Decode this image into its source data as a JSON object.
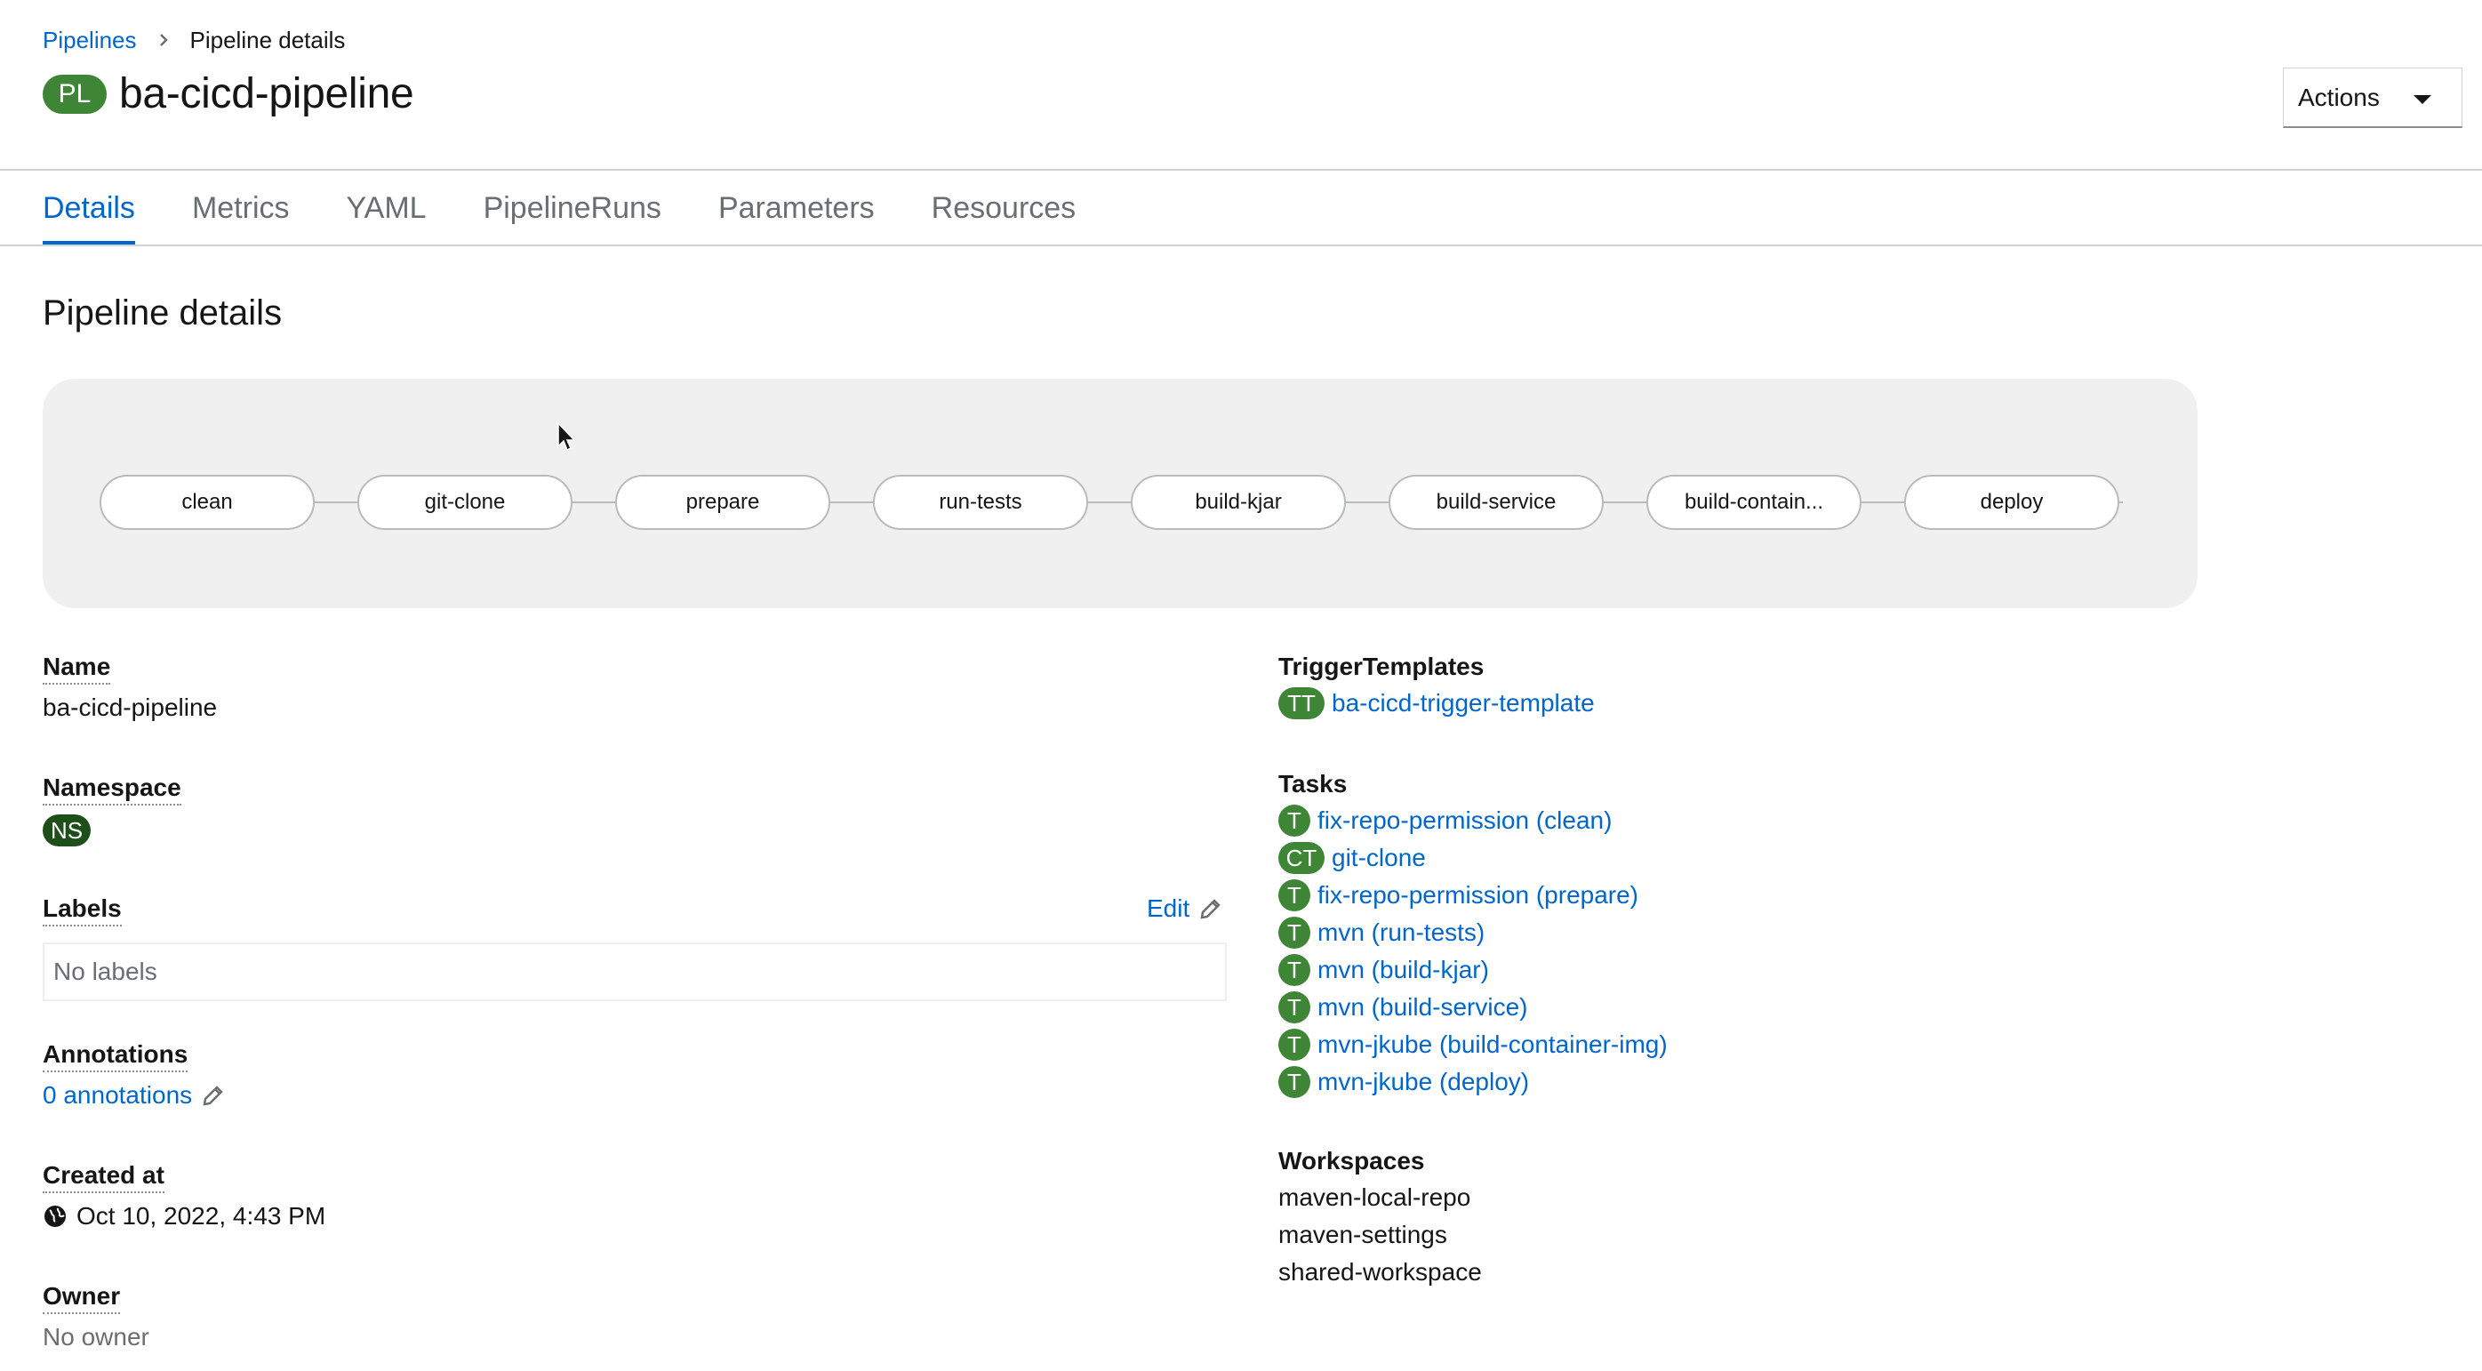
{
  "breadcrumb": {
    "parent": "Pipelines",
    "current": "Pipeline details"
  },
  "header": {
    "badge": "PL",
    "title": "ba-cicd-pipeline",
    "actions_label": "Actions"
  },
  "tabs": [
    "Details",
    "Metrics",
    "YAML",
    "PipelineRuns",
    "Parameters",
    "Resources"
  ],
  "active_tab": "Details",
  "section_title": "Pipeline details",
  "pipeline_nodes": [
    "clean",
    "git-clone",
    "prepare",
    "run-tests",
    "build-kjar",
    "build-service",
    "build-contain...",
    "deploy"
  ],
  "details": {
    "name_label": "Name",
    "name_value": "ba-cicd-pipeline",
    "namespace_label": "Namespace",
    "namespace_badge": "NS",
    "labels_label": "Labels",
    "labels_edit": "Edit",
    "labels_value": "No labels",
    "annotations_label": "Annotations",
    "annotations_value": "0 annotations",
    "created_label": "Created at",
    "created_value": "Oct 10, 2022, 4:43 PM",
    "owner_label": "Owner",
    "owner_value": "No owner"
  },
  "trigger_templates": {
    "label": "TriggerTemplates",
    "items": [
      {
        "badge": "TT",
        "name": "ba-cicd-trigger-template"
      }
    ]
  },
  "tasks": {
    "label": "Tasks",
    "items": [
      {
        "badge": "T",
        "name": "fix-repo-permission (clean)"
      },
      {
        "badge": "CT",
        "name": "git-clone"
      },
      {
        "badge": "T",
        "name": "fix-repo-permission (prepare)"
      },
      {
        "badge": "T",
        "name": "mvn (run-tests)"
      },
      {
        "badge": "T",
        "name": "mvn (build-kjar)"
      },
      {
        "badge": "T",
        "name": "mvn (build-service)"
      },
      {
        "badge": "T",
        "name": "mvn-jkube (build-container-img)"
      },
      {
        "badge": "T",
        "name": "mvn-jkube (deploy)"
      }
    ]
  },
  "workspaces": {
    "label": "Workspaces",
    "items": [
      "maven-local-repo",
      "maven-settings",
      "shared-workspace"
    ]
  },
  "colors": {
    "link": "#0066cc",
    "badge_green": "#3e8635",
    "badge_ns": "#1e4f18"
  }
}
